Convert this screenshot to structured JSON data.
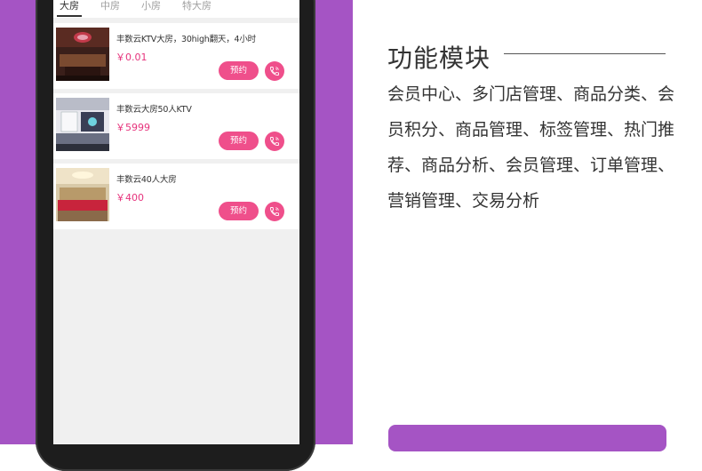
{
  "tabs": [
    {
      "label": "大房",
      "active": true
    },
    {
      "label": "中房",
      "active": false
    },
    {
      "label": "小房",
      "active": false
    },
    {
      "label": "特大房",
      "active": false
    }
  ],
  "rooms": [
    {
      "title": "丰数云KTV大房，30high翻天，4小时",
      "price": "￥0.01",
      "book_label": "预约"
    },
    {
      "title": "丰数云大房50人KTV",
      "price": "￥5999",
      "book_label": "预约"
    },
    {
      "title": "丰数云40人大房",
      "price": "￥400",
      "book_label": "预约"
    }
  ],
  "section": {
    "title": "功能模块",
    "features": "会员中心、多门店管理、商品分类、会员积分、商品管理、标签管理、热门推荐、商品分析、会员管理、订单管理、营销管理、交易分析"
  },
  "colors": {
    "brand_purple": "#a554c4",
    "accent_pink": "#ef4f8b",
    "price_pink": "#e6337c",
    "screen_bg": "#f0f0f0"
  },
  "icons": {
    "call": "phone-icon"
  }
}
